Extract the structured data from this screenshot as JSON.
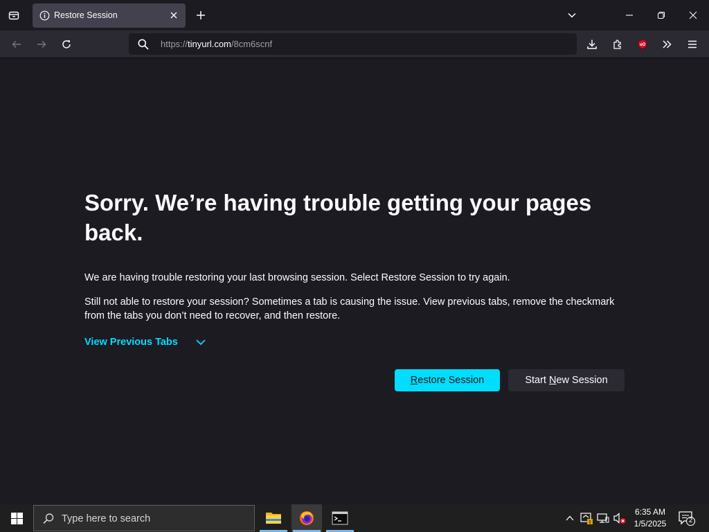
{
  "browser": {
    "tab": {
      "title": "Restore Session"
    },
    "url": {
      "scheme": "https://",
      "host": "tinyurl.com",
      "path": "/8cm6scnf"
    }
  },
  "page": {
    "heading": "Sorry. We’re having trouble getting your pages back.",
    "paragraph1": "We are having trouble restoring your last browsing session. Select Restore Session to try again.",
    "paragraph2": "Still not able to restore your session? Sometimes a tab is causing the issue. View previous tabs, remove the checkmark from the tabs you don’t need to recover, and then restore.",
    "view_previous_tabs": "View Previous Tabs",
    "restore_button": {
      "accel": "R",
      "rest": "estore Session"
    },
    "new_session_button": {
      "before": "Start ",
      "accel": "N",
      "after": "ew Session"
    }
  },
  "taskbar": {
    "search_placeholder": "Type here to search",
    "clock": {
      "time": "6:35 AM",
      "date": "1/5/2025"
    },
    "notification_count": "2"
  },
  "colors": {
    "accent": "#00ddff",
    "page_bg": "#1c1b22",
    "toolbar_bg": "#2b2a33",
    "taskbar_bg": "#1f1f1f"
  },
  "icons": [
    "tab-list-icon",
    "info-icon",
    "close-icon",
    "plus-icon",
    "chevron-down-icon",
    "minimize-icon",
    "restore-icon",
    "back-icon",
    "forward-icon",
    "reload-icon",
    "search-icon",
    "download-icon",
    "extensions-icon",
    "ublock-icon",
    "overflow-icon",
    "menu-icon",
    "windows-icon",
    "file-explorer-icon",
    "firefox-icon",
    "terminal-icon",
    "chevron-up-icon",
    "network-icon",
    "display-icon",
    "volume-muted-icon",
    "notification-icon"
  ]
}
